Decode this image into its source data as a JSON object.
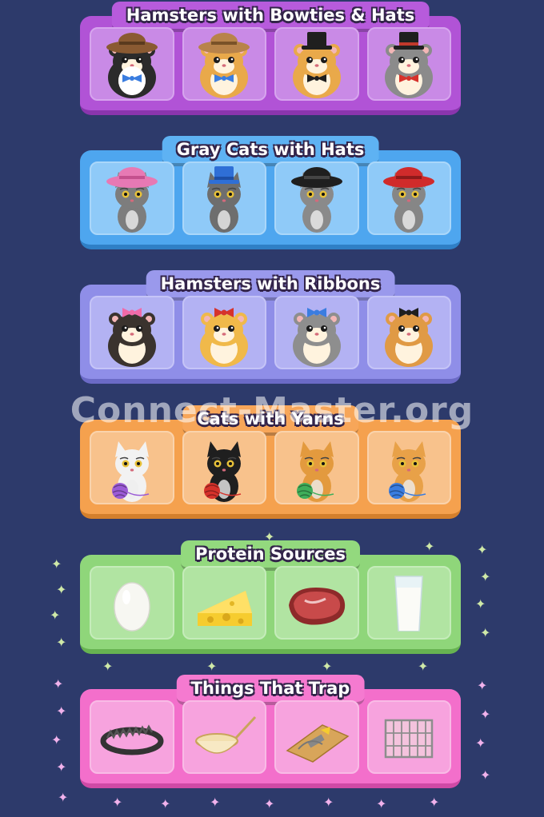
{
  "watermark": "Connect-Master.org",
  "groups": [
    {
      "title": "Hamsters with Bowties & Hats",
      "items": [
        "hamster-brown-hat-blue-bowtie-icon",
        "hamster-brown-hat-blue-bowtie-icon",
        "hamster-black-tophat-bowtie-icon",
        "hamster-gray-tophat-red-bowtie-icon"
      ]
    },
    {
      "title": "Gray Cats with Hats",
      "items": [
        "cat-pink-hat-icon",
        "cat-blue-tophat-icon",
        "cat-black-fedora-icon",
        "cat-red-hat-icon"
      ]
    },
    {
      "title": "Hamsters with Ribbons",
      "items": [
        "hamster-pink-ribbon-icon",
        "hamster-red-ribbon-icon",
        "hamster-blue-ribbon-icon",
        "hamster-black-ribbon-icon"
      ]
    },
    {
      "title": "Cats with Yarns",
      "items": [
        "white-cat-yarn-icon",
        "black-cat-yarn-icon",
        "tabby-cat-yarn-icon",
        "tabby-cat-blue-yarn-icon"
      ]
    },
    {
      "title": "Protein Sources",
      "items": [
        "egg-icon",
        "cheese-icon",
        "steak-icon",
        "milk-glass-icon"
      ]
    },
    {
      "title": "Things That Trap",
      "items": [
        "bear-trap-icon",
        "net-icon",
        "mousetrap-icon",
        "cage-icon"
      ]
    }
  ],
  "colors": {
    "background": "#2d3a6b",
    "purple": "#b153d6",
    "blue": "#4ea6ef",
    "violet": "#8f8ee8",
    "orange": "#f5a14e",
    "green": "#8fd67a",
    "pink": "#f36fcb"
  }
}
